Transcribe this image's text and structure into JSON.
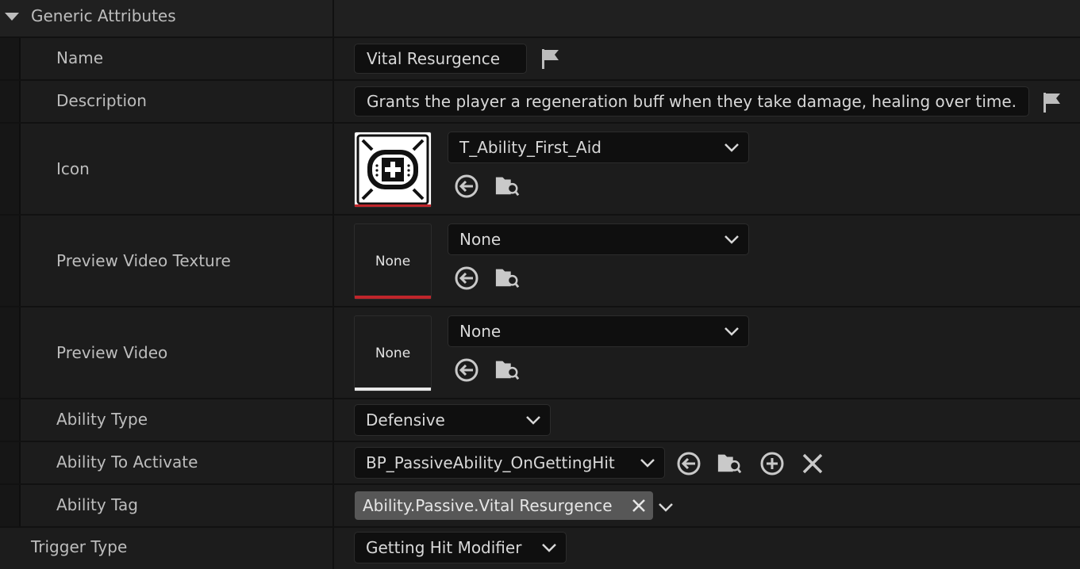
{
  "section": {
    "title": "Generic Attributes"
  },
  "name": {
    "label": "Name",
    "value": "Vital Resurgence"
  },
  "description": {
    "label": "Description",
    "value": "Grants the player a regeneration buff when they take damage, healing over time."
  },
  "icon": {
    "label": "Icon",
    "asset": "T_Ability_First_Aid"
  },
  "preview_video_texture": {
    "label": "Preview Video Texture",
    "asset": "None",
    "thumb_text": "None"
  },
  "preview_video": {
    "label": "Preview Video",
    "asset": "None",
    "thumb_text": "None"
  },
  "ability_type": {
    "label": "Ability Type",
    "value": "Defensive"
  },
  "ability_to_activate": {
    "label": "Ability To Activate",
    "value": "BP_PassiveAbility_OnGettingHit"
  },
  "ability_tag": {
    "label": "Ability Tag",
    "value": "Ability.Passive.Vital Resurgence"
  },
  "trigger_type": {
    "label": "Trigger Type",
    "value": "Getting Hit Modifier"
  },
  "colors": {
    "background": "#1c1c1c",
    "field": "#0f0f0f",
    "tag": "#575757",
    "missing_asset_bar": "#c0252b"
  }
}
